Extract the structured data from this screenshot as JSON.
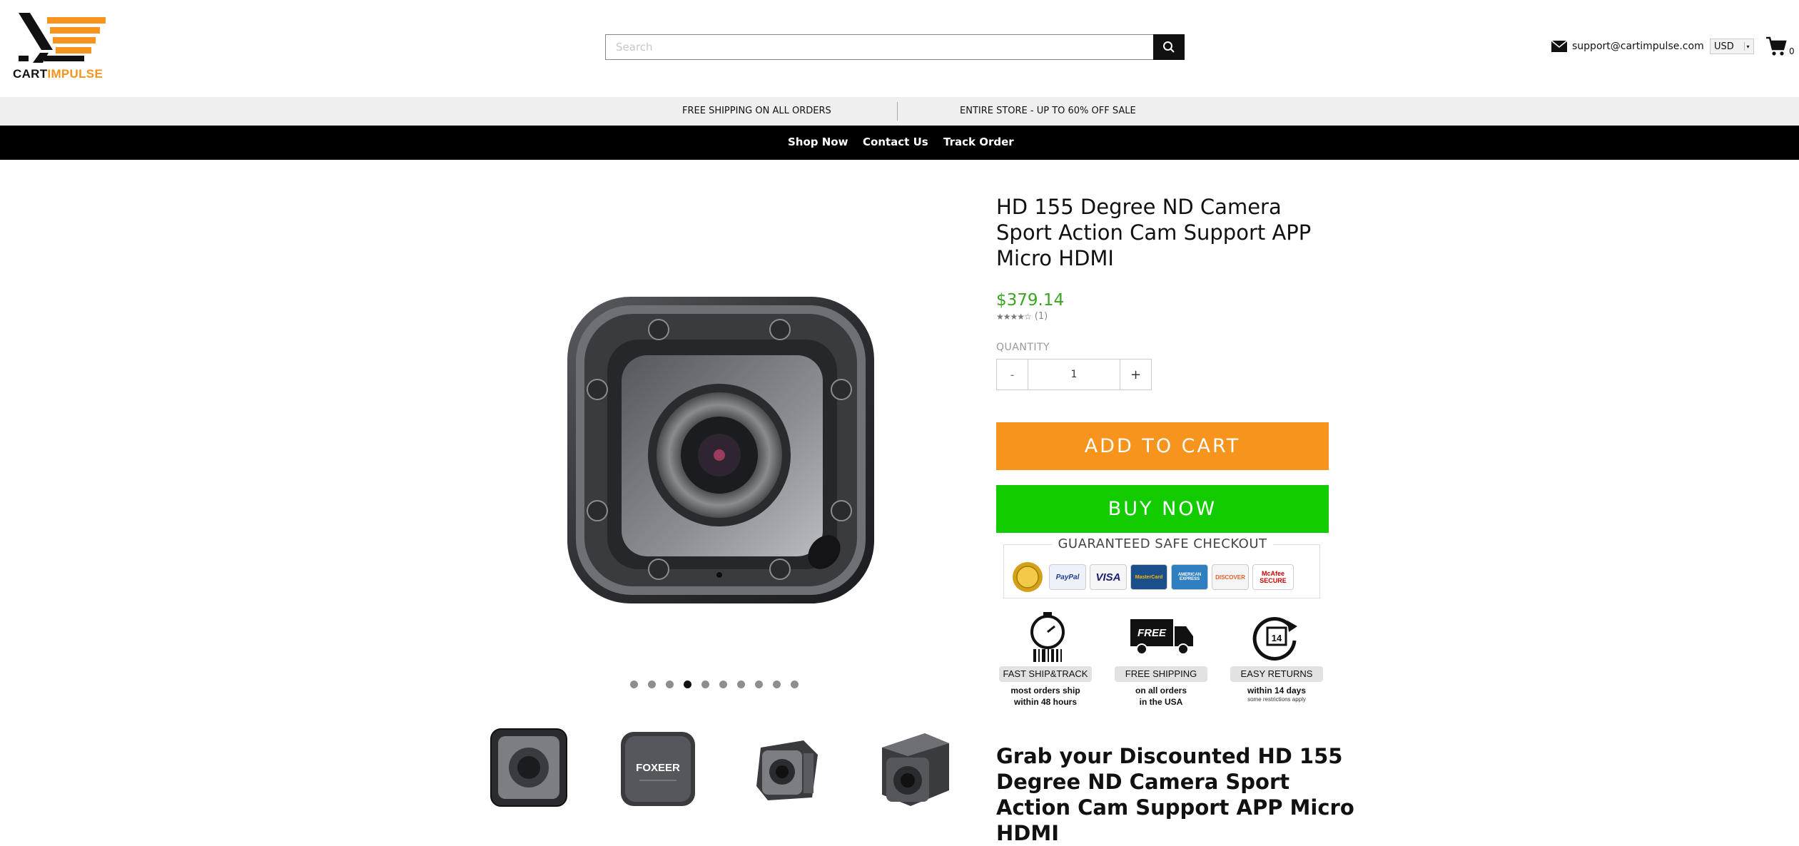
{
  "brand": {
    "name_part1": "CART",
    "name_part2": "IMPULSE",
    "accent": "#f7941d"
  },
  "search": {
    "placeholder": "Search",
    "button_icon": "search-icon"
  },
  "header": {
    "email": "support@cartimpulse.com",
    "currency": "USD",
    "cart_count": "0"
  },
  "promo": {
    "left": "FREE SHIPPING ON ALL ORDERS",
    "right": "ENTIRE STORE - UP TO 60% OFF SALE"
  },
  "nav": {
    "items": [
      {
        "label": "Shop Now"
      },
      {
        "label": "Contact Us"
      },
      {
        "label": "Track Order"
      }
    ]
  },
  "gallery": {
    "slides": 10,
    "active_slide": 4,
    "thumbnail_label": "FOXEER"
  },
  "product": {
    "title": "HD 155 Degree ND Camera Sport Action Cam Support APP Micro HDMI",
    "price": "$379.14",
    "price_color": "#3aa520",
    "rating_stars": 4,
    "rating_count": "(1)",
    "quantity_label": "QUANTITY",
    "quantity_value": "1",
    "minus_label": "-",
    "plus_label": "+",
    "add_to_cart": "ADD TO CART",
    "buy_now": "BUY NOW"
  },
  "checkout": {
    "title": "GUARANTEED SAFE CHECKOUT",
    "badges": [
      "PayPal",
      "VISA",
      "MasterCard",
      "AMERICAN EXPRESS",
      "DISCOVER",
      "McAfee SECURE"
    ]
  },
  "features": [
    {
      "title": "FAST SHIP&TRACK",
      "line1": "most orders ship",
      "line2": "within 48 hours",
      "note": ""
    },
    {
      "title": "FREE SHIPPING",
      "line1": "on all orders",
      "line2": "in the USA",
      "note": "",
      "icon_text": "FREE"
    },
    {
      "title": "EASY RETURNS",
      "line1": "within 14 days",
      "line2": "",
      "note": "some restrictions apply",
      "icon_text": "14"
    }
  ],
  "description_heading": "Grab your Discounted HD 155 Degree ND Camera Sport Action Cam Support APP Micro HDMI"
}
